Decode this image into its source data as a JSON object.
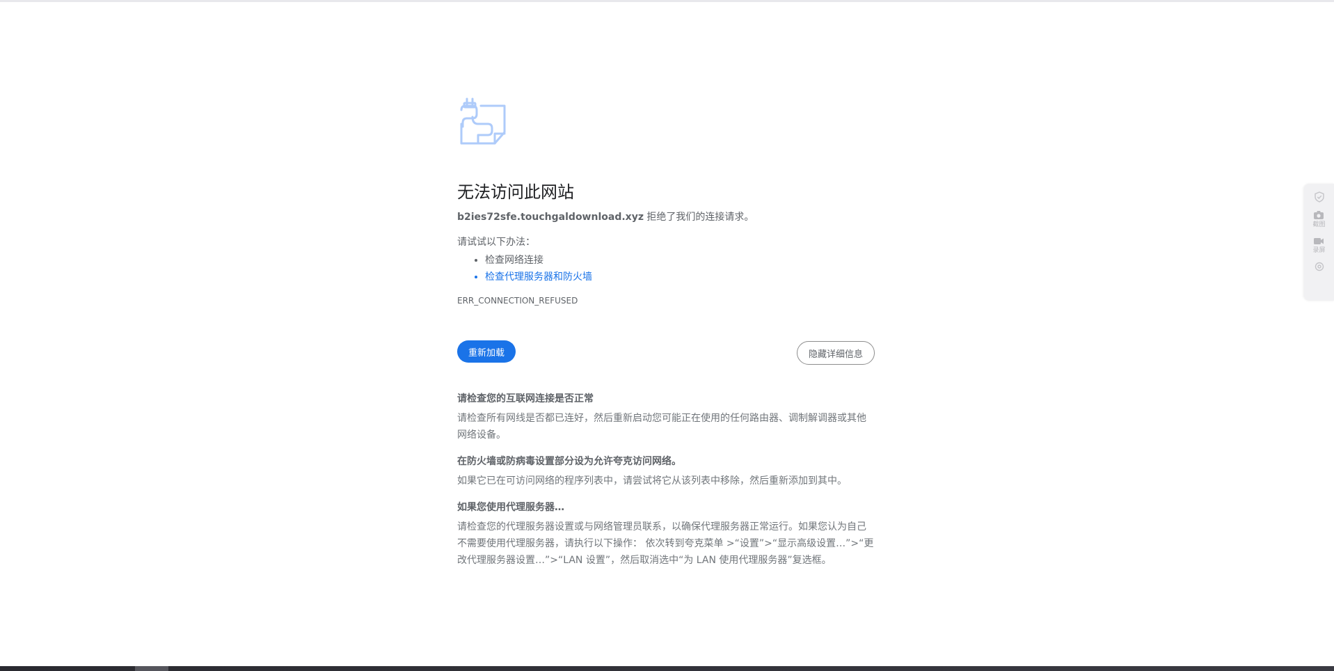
{
  "error": {
    "title": "无法访问此网站",
    "host": "b2ies72sfe.touchgaldownload.xyz",
    "desc_suffix": " 拒绝了我们的连接请求。",
    "suggest_heading": "请试试以下办法：",
    "suggestions": [
      {
        "label": "检查网络连接",
        "link": false
      },
      {
        "label": "检查代理服务器和防火墙",
        "link": true
      }
    ],
    "code": "ERR_CONNECTION_REFUSED"
  },
  "buttons": {
    "reload_label": "重新加载",
    "details_label": "隐藏详细信息"
  },
  "details": [
    {
      "title": "请检查您的互联网连接是否正常",
      "body": "请检查所有网线是否都已连好，然后重新启动您可能正在使用的任何路由器、调制解调器或其他网络设备。"
    },
    {
      "title": "在防火墙或防病毒设置部分设为允许夸克访问网络。",
      "body": "如果它已在可访问网络的程序列表中，请尝试将它从该列表中移除，然后重新添加到其中。"
    },
    {
      "title": "如果您使用代理服务器…",
      "body": "请检查您的代理服务器设置或与网络管理员联系，以确保代理服务器正常运行。如果您认为自己不需要使用代理服务器，请执行以下操作： 依次转到夸克菜单 >“设置”>“显示高级设置…”>“更改代理服务器设置…”>“LAN 设置”，然后取消选中“为 LAN 使用代理服务器”复选框。"
    }
  ],
  "side_panel": {
    "screenshot_label": "截图",
    "record_label": "录屏"
  },
  "colors": {
    "accent": "#1a73e8",
    "icon": "#aecbfa"
  }
}
